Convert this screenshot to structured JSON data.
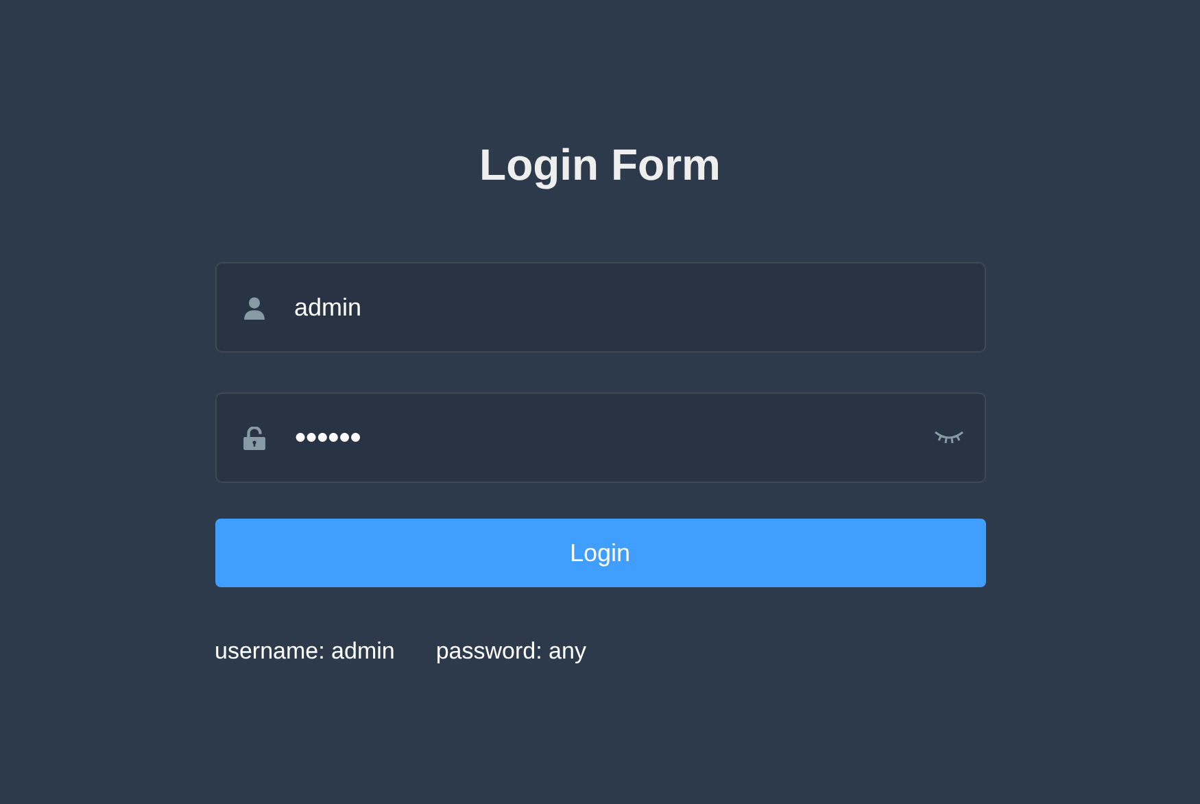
{
  "title": "Login Form",
  "fields": [
    {
      "kind": "username",
      "value": "admin"
    },
    {
      "kind": "password",
      "value": "●●●●●●",
      "reveal": false
    }
  ],
  "login_button": "Login",
  "tips": [
    "username: admin",
    "password: any"
  ]
}
